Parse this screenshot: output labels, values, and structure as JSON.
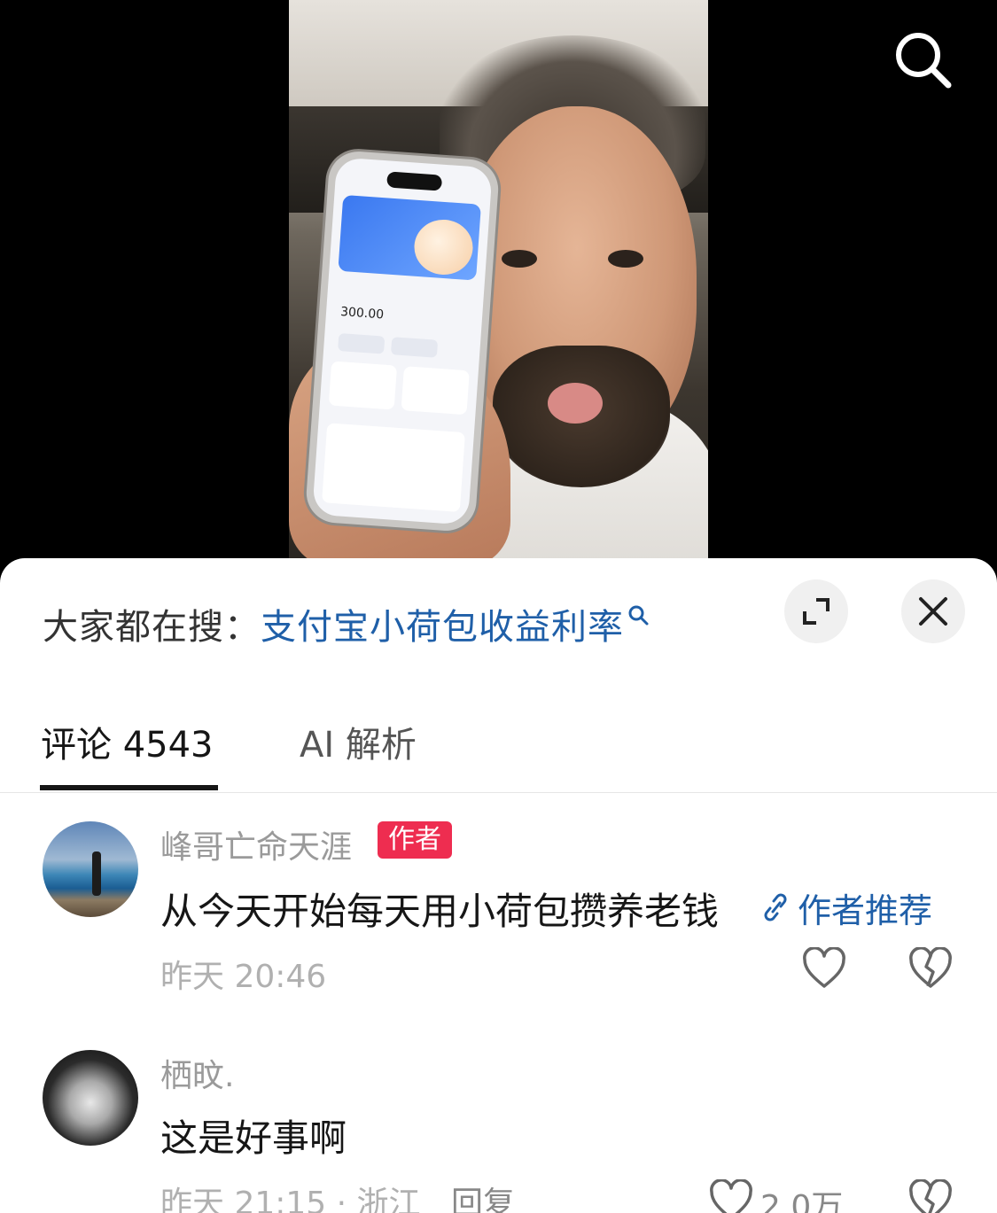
{
  "header": {
    "search_icon": "search-icon"
  },
  "sheet": {
    "hot_search": {
      "prefix": "大家都在搜：",
      "query": "支付宝小荷包收益利率",
      "query_icon": "search-icon"
    },
    "expand_icon": "expand-icon",
    "close_icon": "close-icon",
    "tabs": [
      {
        "label": "评论 4543",
        "active": true
      },
      {
        "label": "AI 解析",
        "active": false
      }
    ]
  },
  "comments": [
    {
      "user": "峰哥亡命天涯",
      "badge": "作者",
      "text": "从今天开始每天用小荷包攒养老钱",
      "link": "作者推荐",
      "time": "昨天 20:46",
      "like_icon": "heart-icon",
      "dislike_icon": "broken-heart-icon"
    },
    {
      "user": "栖旼.",
      "text": "这是好事啊",
      "time": "昨天 21:15 · 浙江",
      "reply": "回复",
      "likes": "2.0万",
      "like_icon": "heart-icon",
      "dislike_icon": "broken-heart-icon"
    }
  ],
  "video": {
    "phone_amount": "300.00"
  },
  "colors": {
    "accent_link": "#1f5fa8",
    "badge": "#ee2d50",
    "tab_text": "#161616"
  }
}
